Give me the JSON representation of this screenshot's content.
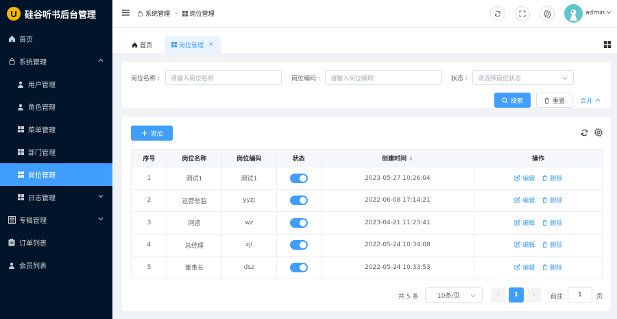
{
  "app": {
    "title": "硅谷听书后台管理"
  },
  "sidebar": {
    "items": [
      {
        "label": "首页",
        "icon": "home-icon"
      },
      {
        "label": "系统管理",
        "icon": "lock-icon"
      },
      {
        "label": "用户管理",
        "icon": "user-icon"
      },
      {
        "label": "角色管理",
        "icon": "user-icon"
      },
      {
        "label": "菜单管理",
        "icon": "grid-icon"
      },
      {
        "label": "部门管理",
        "icon": "grid-icon"
      },
      {
        "label": "岗位管理",
        "icon": "grid-icon"
      },
      {
        "label": "日志管理",
        "icon": "grid-icon"
      },
      {
        "label": "专辑管理",
        "icon": "album-icon"
      },
      {
        "label": "订单列表",
        "icon": "clipboard-icon"
      },
      {
        "label": "会员列表",
        "icon": "user-icon"
      }
    ]
  },
  "header": {
    "breadcrumb": [
      "系统管理",
      "岗位管理"
    ],
    "username": "admin"
  },
  "tabs": [
    {
      "label": "首页"
    },
    {
      "label": "岗位管理"
    }
  ],
  "search": {
    "name_label": "岗位名称 :",
    "name_placeholder": "请输入岗位名称",
    "code_label": "岗位编码 :",
    "code_placeholder": "请输入岗位编码",
    "status_label": "状态 :",
    "status_placeholder": "请选择岗位状态",
    "search_btn": "搜索",
    "reset_btn": "重置",
    "collapse": "合并"
  },
  "table": {
    "add_btn": "添加",
    "headers": [
      "序号",
      "岗位名称",
      "岗位编码",
      "状态",
      "创建时间",
      "操作"
    ],
    "edit_label": "编辑",
    "delete_label": "删除",
    "rows": [
      {
        "index": "1",
        "name": "测试1",
        "code": "测试1",
        "status": true,
        "created": "2023-05-27 10:26:04"
      },
      {
        "index": "2",
        "name": "运营总监",
        "code": "yyzj",
        "status": true,
        "created": "2022-06-08 17:14:21"
      },
      {
        "index": "3",
        "name": "网咨",
        "code": "wz",
        "status": true,
        "created": "2023-04-21 11:23:41"
      },
      {
        "index": "4",
        "name": "总经理",
        "code": "zjl",
        "status": true,
        "created": "2022-05-24 10:34:08"
      },
      {
        "index": "5",
        "name": "董事长",
        "code": "dsz",
        "status": true,
        "created": "2022-05-24 10:33:53"
      }
    ]
  },
  "pagination": {
    "total": "共 5 条",
    "page_size": "10条/页",
    "current": "1",
    "goto_label": "前往",
    "goto_value": "1",
    "page_unit": "页"
  },
  "colors": {
    "sidebar_bg": "#001529",
    "primary": "#409eff",
    "logo": "#f7b500"
  }
}
